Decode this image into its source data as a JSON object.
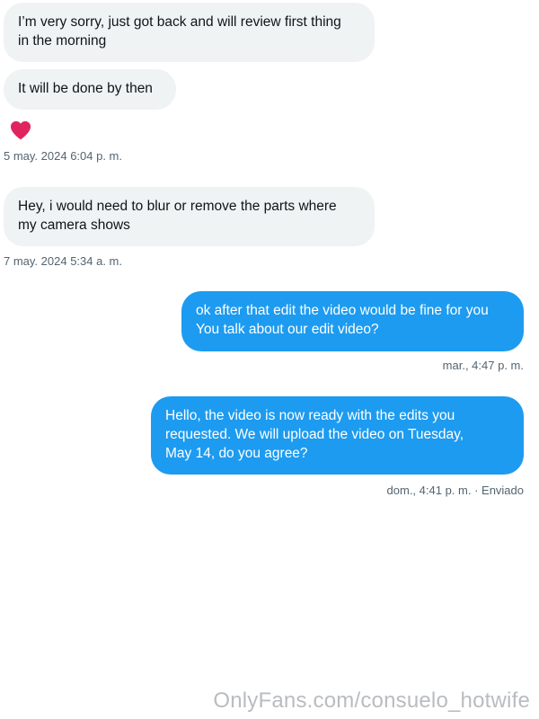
{
  "messages": [
    {
      "direction": "in",
      "lines": [
        "I’m very sorry, just got back and will review first thing",
        "in the morning"
      ]
    },
    {
      "direction": "in",
      "lines": [
        "It will be done by then"
      ]
    },
    {
      "direction": "in",
      "lines": [
        "Hey, i would need to blur or remove the parts where",
        "my camera shows"
      ]
    },
    {
      "direction": "out",
      "lines": [
        "ok after that edit the video would be fine for you",
        "You talk about our edit video?"
      ]
    },
    {
      "direction": "out",
      "lines": [
        "Hello, the video is now ready with the edits you",
        "requested. We will upload the video on Tuesday,",
        "May 14, do you agree?"
      ]
    }
  ],
  "reaction": {
    "icon": "heart-icon",
    "color": "#e0245e"
  },
  "timestamps": {
    "t1": "5 may. 2024 6:04 p. m.",
    "t2": "7 may. 2024 5:34 a. m.",
    "t3": "mar., 4:47 p. m.",
    "t4": "dom., 4:41 p. m. · Enviado"
  },
  "watermark": "OnlyFans.com/consuelo_hotwife",
  "colors": {
    "incoming_bubble": "#eff3f4",
    "outgoing_bubble": "#1d9bf0",
    "timestamp_text": "#536471"
  }
}
